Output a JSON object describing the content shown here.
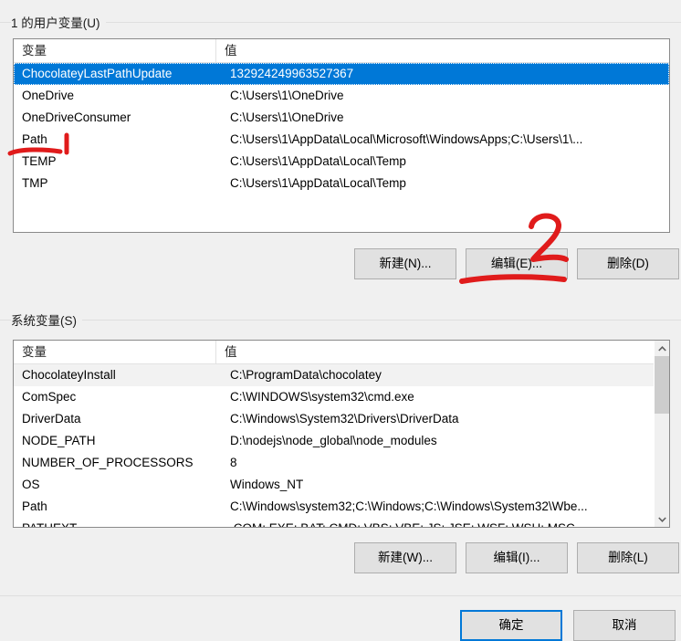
{
  "dialog": {
    "title_user_group": "1 的用户变量(U)",
    "title_system_group": "系统变量(S)"
  },
  "columns": {
    "name": "变量",
    "value": "值"
  },
  "user_variables": {
    "rows": [
      {
        "name": "ChocolateyLastPathUpdate",
        "value": "132924249963527367",
        "state": "selected"
      },
      {
        "name": "OneDrive",
        "value": "C:\\Users\\1\\OneDrive",
        "state": "normal"
      },
      {
        "name": "OneDriveConsumer",
        "value": "C:\\Users\\1\\OneDrive",
        "state": "normal"
      },
      {
        "name": "Path",
        "value": "C:\\Users\\1\\AppData\\Local\\Microsoft\\WindowsApps;C:\\Users\\1\\...",
        "state": "normal"
      },
      {
        "name": "TEMP",
        "value": "C:\\Users\\1\\AppData\\Local\\Temp",
        "state": "normal"
      },
      {
        "name": "TMP",
        "value": "C:\\Users\\1\\AppData\\Local\\Temp",
        "state": "normal"
      }
    ],
    "buttons": {
      "new": "新建(N)...",
      "edit": "编辑(E)...",
      "delete": "删除(D)"
    }
  },
  "system_variables": {
    "rows": [
      {
        "name": "ChocolateyInstall",
        "value": "C:\\ProgramData\\chocolatey",
        "state": "hovered"
      },
      {
        "name": "ComSpec",
        "value": "C:\\WINDOWS\\system32\\cmd.exe",
        "state": "normal"
      },
      {
        "name": "DriverData",
        "value": "C:\\Windows\\System32\\Drivers\\DriverData",
        "state": "normal"
      },
      {
        "name": "NODE_PATH",
        "value": "D:\\nodejs\\node_global\\node_modules",
        "state": "normal"
      },
      {
        "name": "NUMBER_OF_PROCESSORS",
        "value": "8",
        "state": "normal"
      },
      {
        "name": "OS",
        "value": "Windows_NT",
        "state": "normal"
      },
      {
        "name": "Path",
        "value": "C:\\Windows\\system32;C:\\Windows;C:\\Windows\\System32\\Wbe...",
        "state": "normal"
      },
      {
        "name": "PATHEXT",
        "value": ".COM;.EXE;.BAT;.CMD;.VBS;.VBE;.JS;.JSE;.WSF;.WSH;.MSC",
        "state": "clipped"
      }
    ],
    "buttons": {
      "new": "新建(W)...",
      "edit": "编辑(I)...",
      "delete": "删除(L)"
    },
    "scrollbar": {
      "up_arrow": "chevron-up-icon",
      "down_arrow": "chevron-down-icon"
    }
  },
  "footer": {
    "ok": "确定",
    "cancel": "取消"
  },
  "annotations": {
    "mark_one": "1",
    "mark_two": "2",
    "color": "#e01b1b"
  }
}
